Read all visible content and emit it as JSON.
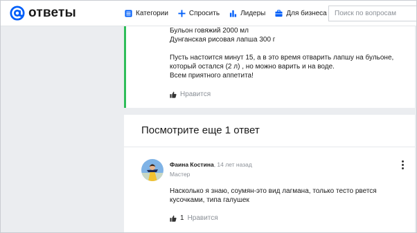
{
  "header": {
    "logo_text": "ответы",
    "nav": [
      {
        "label": "Категории",
        "icon": "list-icon"
      },
      {
        "label": "Спросить",
        "icon": "plus-icon"
      },
      {
        "label": "Лидеры",
        "icon": "bar-chart-icon"
      },
      {
        "label": "Для бизнеса",
        "icon": "briefcase-icon"
      }
    ],
    "search_placeholder": "Поиск по вопросам"
  },
  "answer_top": {
    "lines": [
      "Бульон говяжий 2000 мл",
      "Дунганская рисовая лапша 300 г",
      "",
      "Пусть настоится минут 15, а в это время отварить лапшу на бульоне,",
      "который остался (2 л) , но можно варить и на воде.",
      "Всем приятного аппетита!"
    ],
    "like_label": "Нравится"
  },
  "more_answers": {
    "title": "Посмотрите еще 1 ответ"
  },
  "answer": {
    "author": "Фаина Костина",
    "time": ", 14 лет назад",
    "rank": "Мастер",
    "text_lines": [
      "Насколько я знаю, соумян-это вид лагмана, только тесто рвется",
      "кусочками, типа галушек"
    ],
    "like_count": "1",
    "like_label": "Нравится"
  },
  "colors": {
    "accent_green": "#2ebd59",
    "logo_blue": "#005ff9",
    "nav_icon_blue": "#005ff9"
  }
}
